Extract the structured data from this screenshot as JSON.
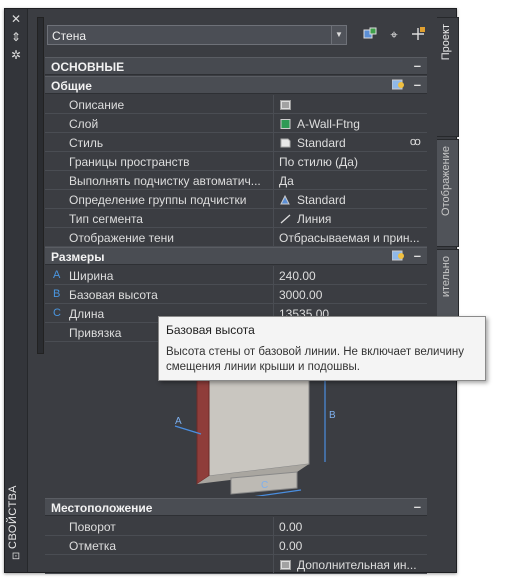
{
  "window": {
    "title": "СВОЙСТВА",
    "tabs": [
      "Проект",
      "Отображение",
      "ительно"
    ]
  },
  "selector": {
    "value": "Стена"
  },
  "categories": {
    "main": "ОСНОВНЫЕ",
    "general": "Общие",
    "dimensions": "Размеры",
    "location": "Местоположение"
  },
  "general_rows": [
    {
      "name": "Описание",
      "value": ""
    },
    {
      "name": "Слой",
      "value": "A-Wall-Ftng"
    },
    {
      "name": "Стиль",
      "value": "Standard"
    },
    {
      "name": "Границы пространств",
      "value": "По стилю (Да)"
    },
    {
      "name": "Выполнять подчистку автоматич...",
      "value": "Да"
    },
    {
      "name": "Определение группы подчистки",
      "value": "Standard"
    },
    {
      "name": "Тип сегмента",
      "value": "Линия"
    },
    {
      "name": "Отображение тени",
      "value": "Отбрасываемая  и  прин..."
    }
  ],
  "dimension_rows": [
    {
      "letter": "A",
      "name": "Ширина",
      "value": "240.00"
    },
    {
      "letter": "B",
      "name": "Базовая высота",
      "value": "3000.00"
    },
    {
      "letter": "C",
      "name": "Длина",
      "value": "13535.00"
    },
    {
      "letter": "",
      "name": "Привязка",
      "value": ""
    }
  ],
  "preview_labels": {
    "a": "A",
    "b": "B",
    "c": "C"
  },
  "location_rows": [
    {
      "name": "Поворот",
      "value": "0.00"
    },
    {
      "name": "Отметка",
      "value": "0.00"
    },
    {
      "name": "",
      "value": "Дополнительная  ин..."
    }
  ],
  "tooltip": {
    "title": "Базовая высота",
    "description": "Высота стены от базовой линии.  Не включает величину смещения линии крыши и подошвы."
  },
  "colors": {
    "panel": "#3b3d42",
    "category": "#4a4d53",
    "accent_letter": "#4a96e0",
    "layer_swatch": "#2e9a55"
  },
  "icons": [
    "close-icon",
    "auto-hide-icon",
    "settings-icon",
    "quick-select-icon",
    "select-objects-icon",
    "toggle-pickadd-icon",
    "highlight-icon",
    "layer-color-icon",
    "style-icon",
    "segment-line-icon"
  ]
}
